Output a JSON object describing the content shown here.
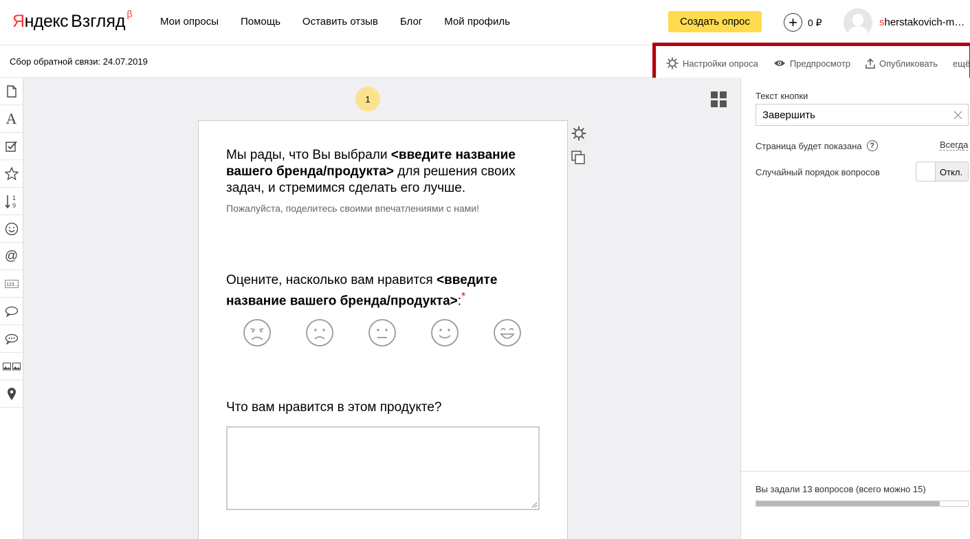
{
  "header": {
    "logo_yandex_first": "Я",
    "logo_yandex_rest": "ндекс",
    "logo_product": "Взгляд",
    "logo_beta": "β",
    "nav": [
      "Мои опросы",
      "Помощь",
      "Оставить отзыв",
      "Блог",
      "Мой профиль"
    ],
    "create_button": "Создать опрос",
    "balance": "0 ₽",
    "username_first": "s",
    "username_rest": "herstakovich-m…"
  },
  "subbar": {
    "survey_title": "Сбор обратной связи: 24.07.2019",
    "toolbar": {
      "settings": "Настройки опроса",
      "preview": "Предпросмотр",
      "publish": "Опубликовать",
      "more": "ещё"
    }
  },
  "tools": [
    "page-icon",
    "text-icon",
    "checkbox-icon",
    "star-icon",
    "sort-icon",
    "smiley-icon",
    "email-icon",
    "number-icon",
    "comment-icon",
    "comments-icon",
    "images-icon",
    "location-icon"
  ],
  "canvas": {
    "page_number": "1",
    "intro_part1": "Мы рады, что Вы выбрали ",
    "intro_bold": "<введите название вашего бренда/продукта>",
    "intro_part2": " для решения своих задач, и стремимся сделать его лучше.",
    "sub_intro": "Пожалуйста, поделитесь своими впечатлениями с нами!",
    "q1_part1": "Оцените, насколько вам нравится ",
    "q1_bold": "<введите название вашего бренда/продукта>",
    "q1_colon": ":",
    "q1_required": "*",
    "smileys": [
      "very-sad-face-icon",
      "sad-face-icon",
      "neutral-face-icon",
      "happy-face-icon",
      "very-happy-face-icon"
    ],
    "q2": "Что вам нравится в этом продукте?"
  },
  "panel": {
    "button_text_label": "Текст кнопки",
    "button_text_value": "Завершить",
    "page_shown_label": "Страница будет показана",
    "page_shown_value": "Всегда",
    "random_order_label": "Случайный порядок вопросов",
    "random_order_toggle": "Откл.",
    "questions_count": "Вы задали 13 вопросов (всего можно 15)",
    "questions_used": 13,
    "questions_max": 15
  },
  "colors": {
    "accent_yellow": "#ffdb4d",
    "brand_red": "#ff3333",
    "highlight_border": "#b3000f"
  }
}
